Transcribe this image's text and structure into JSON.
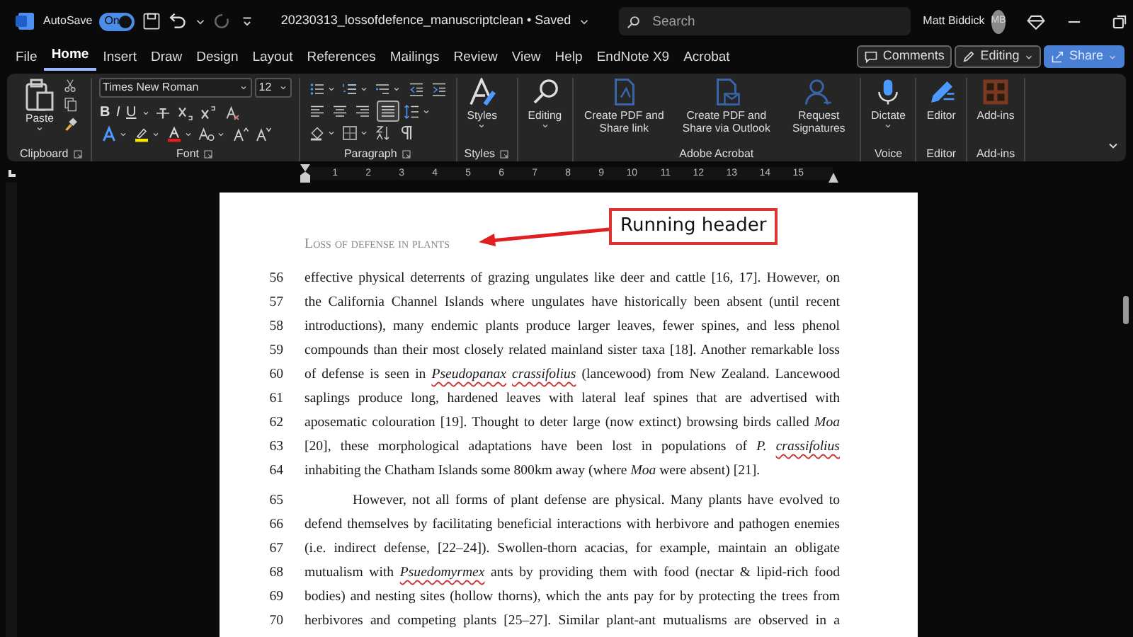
{
  "title_bar": {
    "autosave_label": "AutoSave",
    "autosave_toggle": {
      "label": "On",
      "on": true
    },
    "document_title": "20230313_lossofdefence_manuscriptclean • Saved",
    "search": {
      "placeholder": "Search"
    },
    "user_name": "Matt Biddick",
    "avatar_initials": "MB"
  },
  "ribbon_tabs": [
    {
      "label": "File",
      "selected": false
    },
    {
      "label": "Home",
      "selected": true
    },
    {
      "label": "Insert",
      "selected": false
    },
    {
      "label": "Draw",
      "selected": false
    },
    {
      "label": "Design",
      "selected": false
    },
    {
      "label": "Layout",
      "selected": false
    },
    {
      "label": "References",
      "selected": false
    },
    {
      "label": "Mailings",
      "selected": false
    },
    {
      "label": "Review",
      "selected": false
    },
    {
      "label": "View",
      "selected": false
    },
    {
      "label": "Help",
      "selected": false
    },
    {
      "label": "EndNote X9",
      "selected": false
    },
    {
      "label": "Acrobat",
      "selected": false
    }
  ],
  "ribbon_actions": [
    {
      "label": "Comments",
      "kind": "comments"
    },
    {
      "label": "Editing",
      "kind": "editing"
    },
    {
      "label": "Share",
      "kind": "share"
    }
  ],
  "ribbon_groups": [
    {
      "kind": "clipboard",
      "label": "Clipboard",
      "launcher": true,
      "paste_label": "Paste"
    },
    {
      "kind": "font",
      "label": "Font",
      "launcher": true,
      "font_name": "Times New Roman",
      "font_size": "12",
      "style_buttons": [
        "B",
        "I",
        "U"
      ]
    },
    {
      "kind": "paragraph",
      "label": "Paragraph",
      "launcher": true,
      "alignments": [
        {
          "kind": "left",
          "selected": false
        },
        {
          "kind": "center",
          "selected": false
        },
        {
          "kind": "right",
          "selected": false
        },
        {
          "kind": "justify",
          "selected": true
        }
      ]
    },
    {
      "kind": "large",
      "label": "Styles",
      "launcher": true,
      "buttons": [
        {
          "label": "Styles",
          "kind": "styles",
          "dropdown": true
        }
      ]
    },
    {
      "kind": "large",
      "launcher": false,
      "buttons": [
        {
          "label": "Editing",
          "kind": "search",
          "dropdown": true
        }
      ]
    },
    {
      "kind": "large",
      "label": "Adobe Acrobat",
      "launcher": false,
      "buttons": [
        {
          "label": "Create PDF and Share link",
          "kind": "pdf",
          "dropdown": false
        },
        {
          "label": "Create PDF and Share via Outlook",
          "kind": "pdfmail",
          "dropdown": false
        },
        {
          "label": "Request Signatures",
          "kind": "sign",
          "dropdown": false
        }
      ]
    },
    {
      "kind": "large",
      "label": "Voice",
      "launcher": false,
      "buttons": [
        {
          "label": "Dictate",
          "kind": "mic",
          "dropdown": true
        }
      ]
    },
    {
      "kind": "large",
      "label": "Editor",
      "launcher": false,
      "buttons": [
        {
          "label": "Editor",
          "kind": "pen",
          "dropdown": false
        }
      ]
    },
    {
      "kind": "large",
      "label": "Add-ins",
      "launcher": false,
      "buttons": [
        {
          "label": "Add-ins",
          "kind": "addins",
          "dropdown": false
        }
      ]
    }
  ],
  "ruler_numbers": [
    "1",
    "2",
    "3",
    "4",
    "5",
    "6",
    "7",
    "8",
    "9",
    "10",
    "11",
    "12",
    "13",
    "14",
    "15"
  ],
  "document": {
    "running_header": "Loss of defense in plants",
    "callout": "Running header",
    "paragraphs": [
      {
        "first_line_indent": false,
        "lines": [
          {
            "number": "56",
            "segments": [
              {
                "text": "effective physical deterrents of grazing ungulates like deer and cattle [16, 17]. However, on",
                "italic": false,
                "flagged": false
              }
            ]
          },
          {
            "number": "57",
            "segments": [
              {
                "text": "the California Channel Islands where ungulates have historically been absent (until recent",
                "italic": false,
                "flagged": false
              }
            ]
          },
          {
            "number": "58",
            "segments": [
              {
                "text": "introductions), many endemic plants produce larger leaves, fewer spines, and less phenol",
                "italic": false,
                "flagged": false
              }
            ]
          },
          {
            "number": "59",
            "segments": [
              {
                "text": "compounds than their most closely related mainland sister taxa [18]. Another remarkable loss",
                "italic": false,
                "flagged": false
              }
            ]
          },
          {
            "number": "60",
            "segments": [
              {
                "text": "of defense is seen in ",
                "italic": false,
                "flagged": false
              },
              {
                "text": "Pseudopanax crassifolius",
                "italic": true,
                "flagged": true
              },
              {
                "text": " (lancewood) from New Zealand. Lancewood",
                "italic": false,
                "flagged": false
              }
            ]
          },
          {
            "number": "61",
            "segments": [
              {
                "text": "saplings produce long, hardened leaves with lateral leaf spines that are advertised with",
                "italic": false,
                "flagged": false
              }
            ]
          },
          {
            "number": "62",
            "segments": [
              {
                "text": "aposematic colouration [19]. Thought to deter large (now extinct) browsing birds called ",
                "italic": false,
                "flagged": false
              },
              {
                "text": "Moa",
                "italic": true,
                "flagged": false
              }
            ]
          },
          {
            "number": "63",
            "segments": [
              {
                "text": "[20], these morphological adaptations have been lost in populations of ",
                "italic": false,
                "flagged": false
              },
              {
                "text": "P. ",
                "italic": true,
                "flagged": false
              },
              {
                "text": "crassifolius",
                "italic": true,
                "flagged": true
              }
            ]
          },
          {
            "number": "64",
            "segments": [
              {
                "text": "inhabiting the Chatham Islands some 800km away (where ",
                "italic": false,
                "flagged": false
              },
              {
                "text": "Moa",
                "italic": true,
                "flagged": false
              },
              {
                "text": " were absent) [21].",
                "italic": false,
                "flagged": false
              }
            ]
          }
        ]
      },
      {
        "first_line_indent": true,
        "lines": [
          {
            "number": "65",
            "segments": [
              {
                "text": "However, not all forms of plant defense are physical. Many plants have evolved to",
                "italic": false,
                "flagged": false
              }
            ]
          },
          {
            "number": "66",
            "segments": [
              {
                "text": "defend themselves by facilitating beneficial interactions with herbivore and pathogen enemies",
                "italic": false,
                "flagged": false
              }
            ]
          },
          {
            "number": "67",
            "segments": [
              {
                "text": "(i.e. indirect defense, [22–24]). Swollen-thorn acacias, for example, maintain an obligate",
                "italic": false,
                "flagged": false
              }
            ]
          },
          {
            "number": "68",
            "segments": [
              {
                "text": "mutualism with ",
                "italic": false,
                "flagged": false
              },
              {
                "text": "Psuedomyrmex",
                "italic": true,
                "flagged": true
              },
              {
                "text": " ants by providing them with food (nectar & lipid-rich food",
                "italic": false,
                "flagged": false
              }
            ]
          },
          {
            "number": "69",
            "segments": [
              {
                "text": "bodies) and nesting sites (hollow thorns), which the ants pay for by protecting the trees from",
                "italic": false,
                "flagged": false
              }
            ]
          },
          {
            "number": "70",
            "segments": [
              {
                "text": "herbivores and competing plants [25–27]. Similar plant-ant mutualisms are observed in a",
                "italic": false,
                "flagged": false
              }
            ]
          }
        ],
        "continues": true
      }
    ]
  }
}
